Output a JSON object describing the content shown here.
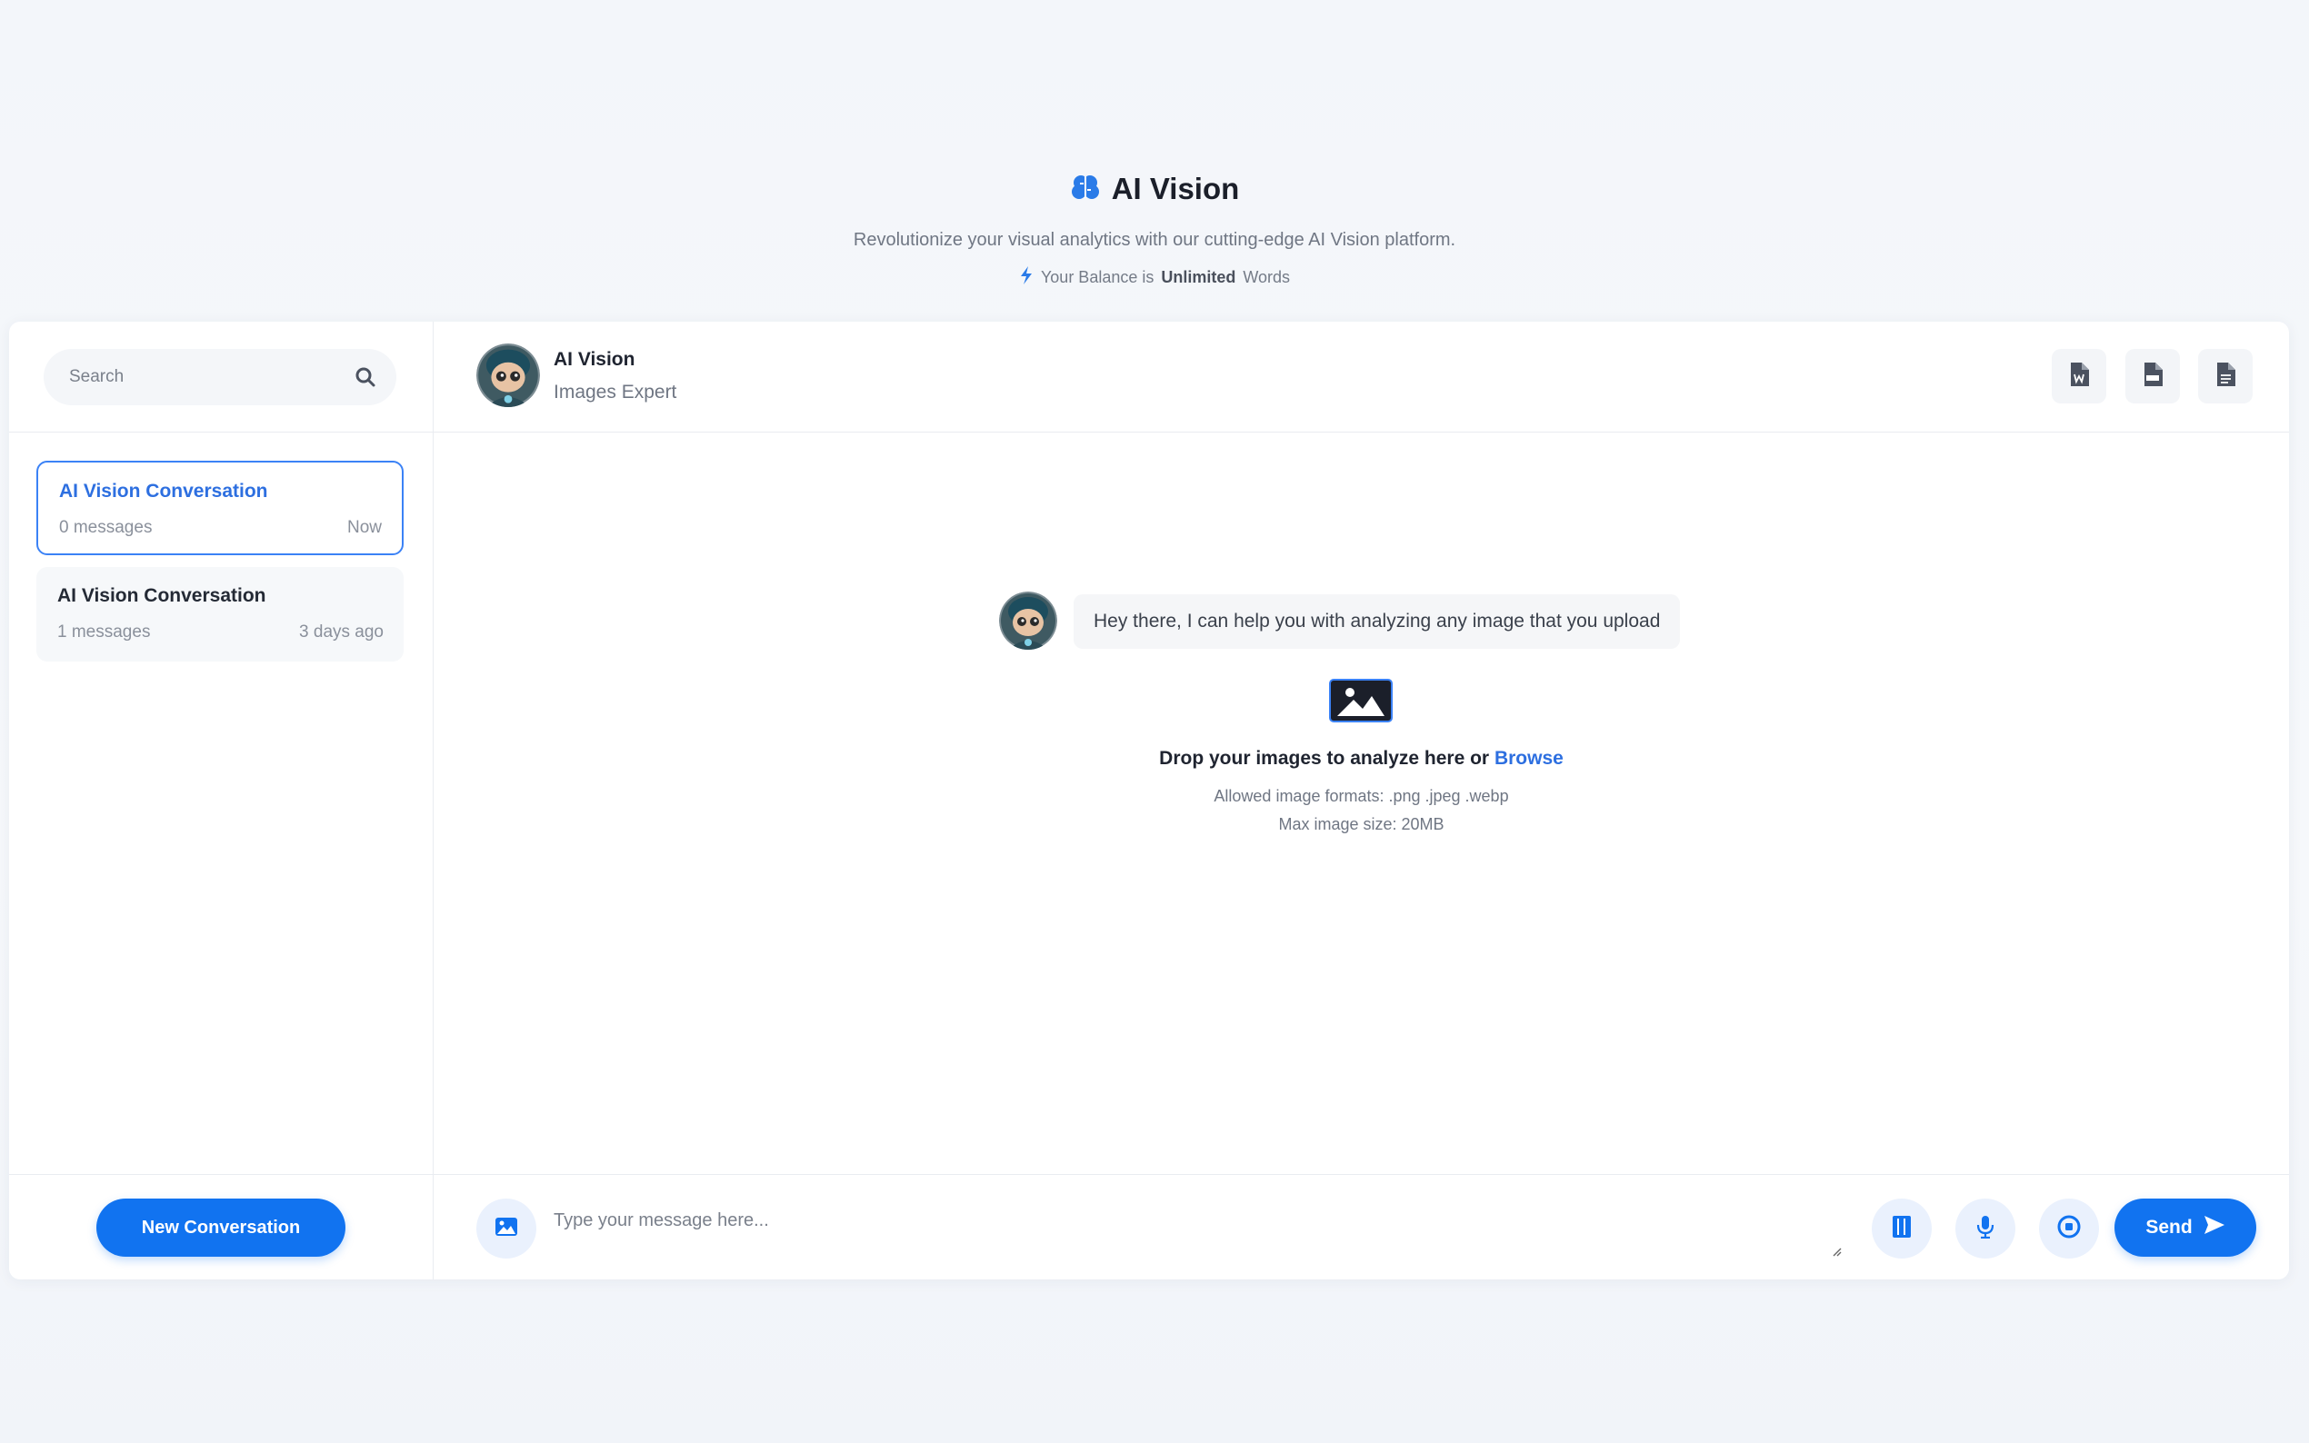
{
  "header": {
    "title": "AI Vision",
    "subtitle": "Revolutionize your visual analytics with our cutting-edge AI Vision platform.",
    "balance_prefix": "Your Balance is",
    "balance_value": "Unlimited",
    "balance_suffix": "Words",
    "accent_color": "#1173f0"
  },
  "sidebar": {
    "search_placeholder": "Search",
    "conversations": [
      {
        "title": "AI Vision Conversation",
        "messages": "0 messages",
        "date": "Now",
        "active": true
      },
      {
        "title": "AI Vision Conversation",
        "messages": "1 messages",
        "date": "3 days ago",
        "active": false
      }
    ],
    "new_conversation_label": "New Conversation"
  },
  "chat": {
    "name": "AI Vision",
    "role": "Images Expert",
    "toolbar_icons": [
      "word-export-icon",
      "pdf-export-icon",
      "txt-export-icon"
    ],
    "greeting": "Hey there, I can help you with analyzing any image that you upload",
    "drop_text": "Drop your images to analyze here or",
    "browse_label": "Browse",
    "formats": "Allowed image formats: .png .jpeg .webp",
    "max_size": "Max image size: 20MB",
    "input_placeholder": "Type your message here...",
    "send_label": "Send"
  }
}
